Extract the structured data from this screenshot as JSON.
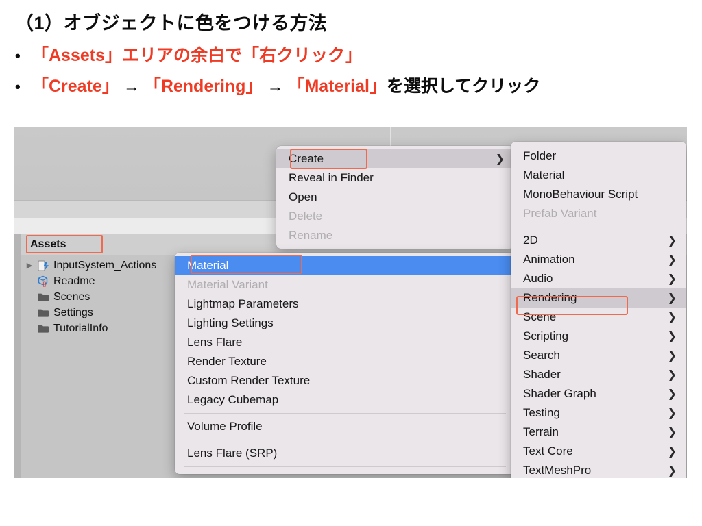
{
  "slide": {
    "title": "（1）オブジェクトに色をつける方法",
    "bullets": [
      {
        "marker": "•",
        "parts": [
          {
            "text": "「Assets」エリアの余白で「右クリック」",
            "style": "highlight"
          }
        ]
      },
      {
        "marker": "•",
        "parts": [
          {
            "text": "「Create」",
            "style": "highlight"
          },
          {
            "text": "→",
            "style": "arrow"
          },
          {
            "text": "「Rendering」",
            "style": "highlight"
          },
          {
            "text": "→",
            "style": "arrow"
          },
          {
            "text": "「Material」",
            "style": "highlight"
          },
          {
            "text": "を選択してクリック",
            "style": "normal"
          }
        ]
      }
    ],
    "colors": {
      "highlight": "#ef3b24",
      "text": "#0d0d0d",
      "callout": "#ef6a4e",
      "menu_selection_blue": "#4a8cf0",
      "menu_hover_grey": "#cfcacf",
      "menu_background": "#ebe6ea"
    },
    "bullet_line_1_text": "「Assets」エリアの余白で「右クリック」"
  },
  "editor": {
    "project_panel": {
      "header_label": "Assets",
      "tree": [
        {
          "label": "InputSystem_Actions",
          "icon": "input-actions-icon",
          "expandable": true
        },
        {
          "label": "Readme",
          "icon": "readme-cube-icon",
          "expandable": false
        },
        {
          "label": "Scenes",
          "icon": "folder-icon",
          "expandable": false
        },
        {
          "label": "Settings",
          "icon": "folder-icon",
          "expandable": false
        },
        {
          "label": "TutorialInfo",
          "icon": "folder-icon",
          "expandable": false
        }
      ]
    },
    "context_menu": {
      "items": [
        {
          "label": "Create",
          "state": "hover",
          "submenu": true
        },
        {
          "label": "Reveal in Finder",
          "state": "normal",
          "submenu": false
        },
        {
          "label": "Open",
          "state": "normal",
          "submenu": false
        },
        {
          "label": "Delete",
          "state": "disabled",
          "submenu": false
        },
        {
          "label": "Rename",
          "state": "disabled",
          "submenu": false
        }
      ]
    },
    "create_menu": {
      "items": [
        {
          "label": "Material",
          "state": "selected",
          "submenu": false
        },
        {
          "label": "Material Variant",
          "state": "disabled",
          "submenu": false
        },
        {
          "label": "Lightmap Parameters",
          "state": "normal",
          "submenu": false
        },
        {
          "label": "Lighting Settings",
          "state": "normal",
          "submenu": false
        },
        {
          "label": "Lens Flare",
          "state": "normal",
          "submenu": false
        },
        {
          "label": "Render Texture",
          "state": "normal",
          "submenu": false
        },
        {
          "label": "Custom Render Texture",
          "state": "normal",
          "submenu": false
        },
        {
          "label": "Legacy Cubemap",
          "state": "normal",
          "submenu": false
        },
        {
          "separator": true
        },
        {
          "label": "Volume Profile",
          "state": "normal",
          "submenu": false
        },
        {
          "separator": true
        },
        {
          "label": "Lens Flare (SRP)",
          "state": "normal",
          "submenu": false
        },
        {
          "separator": true
        }
      ]
    },
    "category_menu": {
      "items": [
        {
          "label": "Folder",
          "state": "normal",
          "submenu": false
        },
        {
          "label": "Material",
          "state": "normal",
          "submenu": false
        },
        {
          "label": "MonoBehaviour Script",
          "state": "normal",
          "submenu": false
        },
        {
          "label": "Prefab Variant",
          "state": "disabled",
          "submenu": false
        },
        {
          "separator": true
        },
        {
          "label": "2D",
          "state": "normal",
          "submenu": true
        },
        {
          "label": "Animation",
          "state": "normal",
          "submenu": true
        },
        {
          "label": "Audio",
          "state": "normal",
          "submenu": true
        },
        {
          "label": "Rendering",
          "state": "hover",
          "submenu": true
        },
        {
          "label": "Scene",
          "state": "normal",
          "submenu": true
        },
        {
          "label": "Scripting",
          "state": "normal",
          "submenu": true
        },
        {
          "label": "Search",
          "state": "normal",
          "submenu": true
        },
        {
          "label": "Shader",
          "state": "normal",
          "submenu": true
        },
        {
          "label": "Shader Graph",
          "state": "normal",
          "submenu": true
        },
        {
          "label": "Testing",
          "state": "normal",
          "submenu": true
        },
        {
          "label": "Terrain",
          "state": "normal",
          "submenu": true
        },
        {
          "label": "Text Core",
          "state": "normal",
          "submenu": true
        },
        {
          "label": "TextMeshPro",
          "state": "normal",
          "submenu": true
        }
      ]
    },
    "submenu_arrow_glyph": "❯"
  }
}
